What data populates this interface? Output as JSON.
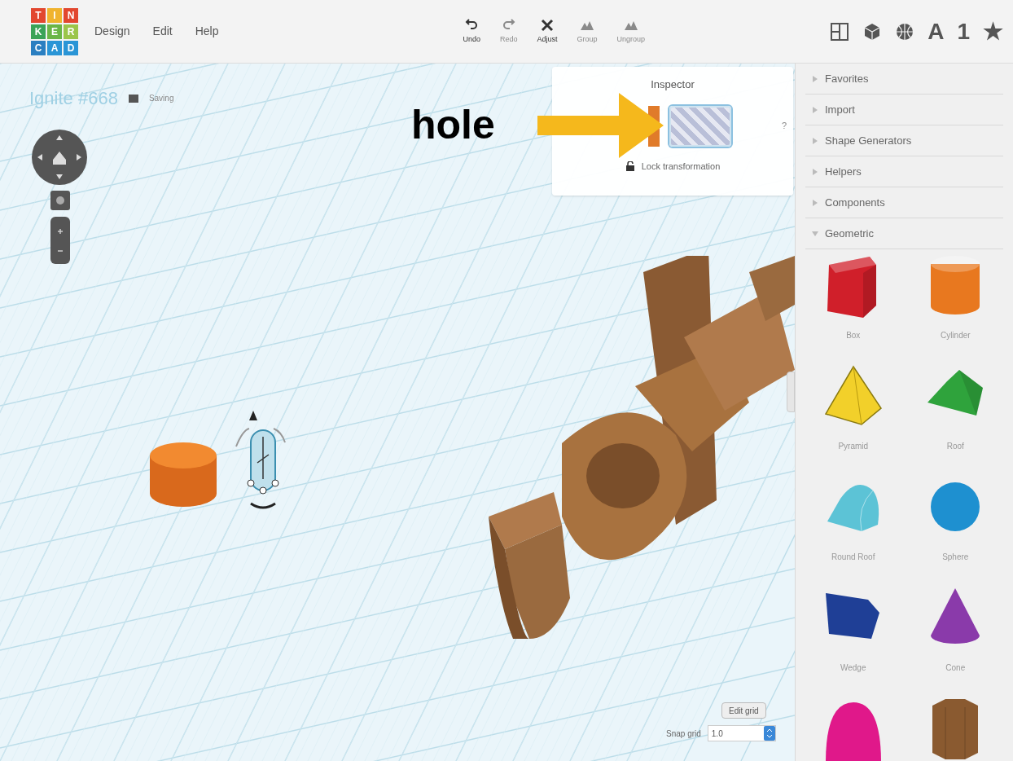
{
  "logo": {
    "letters": [
      {
        "char": "T",
        "color": "#e2472f"
      },
      {
        "char": "I",
        "color": "#f0b32e"
      },
      {
        "char": "N",
        "color": "#e2472f"
      },
      {
        "char": "K",
        "color": "#3aa357"
      },
      {
        "char": "E",
        "color": "#6bb647"
      },
      {
        "char": "R",
        "color": "#9bc54a"
      },
      {
        "char": "C",
        "color": "#2a7fc1"
      },
      {
        "char": "A",
        "color": "#2a95d6"
      },
      {
        "char": "D",
        "color": "#2a95d6"
      }
    ]
  },
  "menu": [
    "Design",
    "Edit",
    "Help"
  ],
  "toolbar": [
    {
      "kind": "undo",
      "label": "Undo",
      "disabled": false
    },
    {
      "kind": "redo",
      "label": "Redo",
      "disabled": true
    },
    {
      "kind": "adjust",
      "label": "Adjust",
      "disabled": false
    },
    {
      "kind": "group",
      "label": "Group",
      "disabled": true
    },
    {
      "kind": "ungroup",
      "label": "Ungroup",
      "disabled": true
    }
  ],
  "header_icons": [
    {
      "kind": "grid"
    },
    {
      "kind": "cube"
    },
    {
      "kind": "ball"
    },
    {
      "kind": "glyph",
      "label": "A"
    },
    {
      "kind": "glyph",
      "label": "1"
    },
    {
      "kind": "glyph",
      "label": "★"
    }
  ],
  "project": {
    "title": "Ignite #668",
    "status": "Saving"
  },
  "annotation": {
    "label": "hole"
  },
  "inspector": {
    "title": "Inspector",
    "help": "?",
    "lock_label": "Lock transformation",
    "swatches": [
      {
        "kind": "solid",
        "color": "#e07b2a",
        "selected": false
      },
      {
        "kind": "hole",
        "selected": true
      }
    ]
  },
  "sidebar": {
    "sections": [
      {
        "label": "Favorites",
        "expanded": false
      },
      {
        "label": "Import",
        "expanded": false
      },
      {
        "label": "Shape Generators",
        "expanded": false
      },
      {
        "label": "Helpers",
        "expanded": false
      },
      {
        "label": "Components",
        "expanded": false
      },
      {
        "label": "Geometric",
        "expanded": true
      }
    ],
    "shapes": [
      {
        "kind": "box",
        "label": "Box",
        "color": "#d01f2a"
      },
      {
        "kind": "cylinder",
        "label": "Cylinder",
        "color": "#e8781f"
      },
      {
        "kind": "pyramid",
        "label": "Pyramid",
        "color": "#f2d02a"
      },
      {
        "kind": "roof",
        "label": "Roof",
        "color": "#2fa33c"
      },
      {
        "kind": "roundroof",
        "label": "Round Roof",
        "color": "#5cc3d6"
      },
      {
        "kind": "sphere",
        "label": "Sphere",
        "color": "#1e90d0"
      },
      {
        "kind": "wedge",
        "label": "Wedge",
        "color": "#1f3f96"
      },
      {
        "kind": "cone",
        "label": "Cone",
        "color": "#8a3aaa"
      },
      {
        "kind": "halfsphere",
        "color": "#e0188a"
      },
      {
        "kind": "polygon",
        "color": "#8a5a30"
      }
    ]
  },
  "grid_controls": {
    "edit_button": "Edit grid",
    "snap_label": "Snap grid",
    "snap_value": "1.0"
  }
}
